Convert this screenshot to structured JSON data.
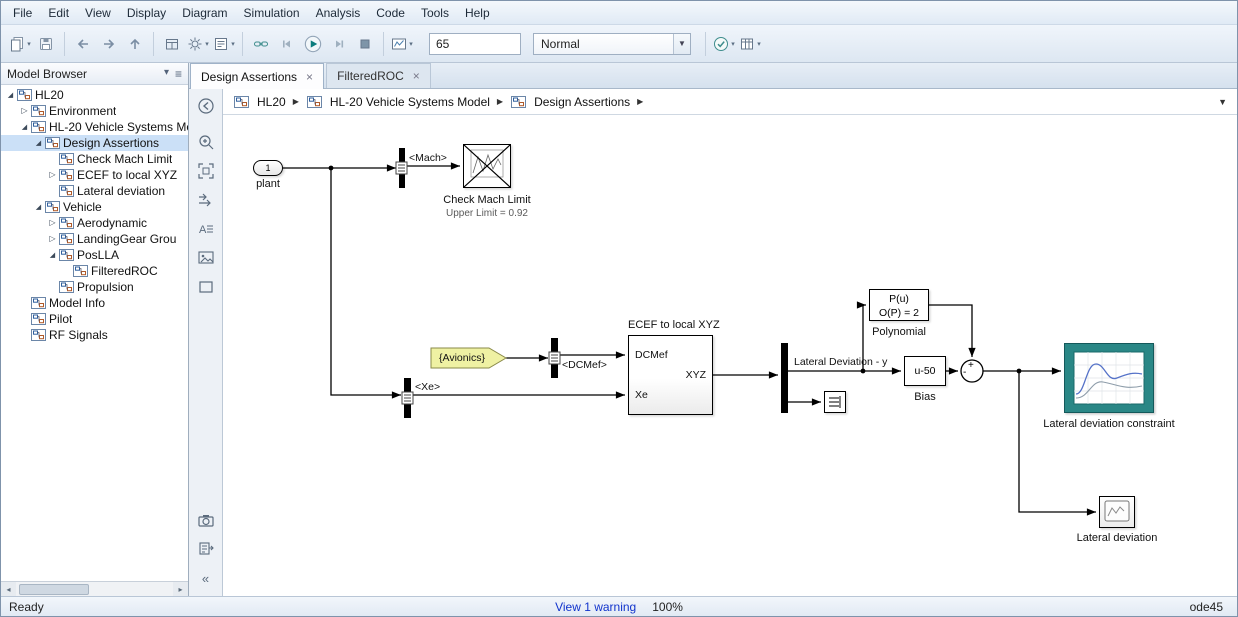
{
  "menu_bar": {
    "items": [
      "File",
      "Edit",
      "View",
      "Display",
      "Diagram",
      "Simulation",
      "Analysis",
      "Code",
      "Tools",
      "Help"
    ]
  },
  "toolbar": {
    "sim_stop_time": "65",
    "sim_mode": "Normal",
    "buttons": [
      "new-model",
      "save",
      "back",
      "forward",
      "up",
      "window-layout",
      "settings",
      "model-properties",
      "link",
      "step-back",
      "run",
      "step-forward",
      "stop",
      "simulation-data-display",
      "model-advisor",
      "build"
    ]
  },
  "model_browser": {
    "title": "Model Browser",
    "items": [
      {
        "label": "HL20",
        "depth": 0,
        "state": "expanded"
      },
      {
        "label": "Environment",
        "depth": 1,
        "state": "collapsed"
      },
      {
        "label": "HL-20 Vehicle Systems Mo",
        "depth": 1,
        "state": "expanded"
      },
      {
        "label": "Design Assertions",
        "depth": 2,
        "state": "expanded",
        "selected": true
      },
      {
        "label": "Check Mach Limit",
        "depth": 3,
        "state": "leaf"
      },
      {
        "label": "ECEF to local XYZ",
        "depth": 3,
        "state": "collapsed"
      },
      {
        "label": "Lateral deviation",
        "depth": 3,
        "state": "leaf"
      },
      {
        "label": "Vehicle",
        "depth": 2,
        "state": "expanded"
      },
      {
        "label": "Aerodynamic",
        "depth": 3,
        "state": "collapsed"
      },
      {
        "label": "LandingGear Grou",
        "depth": 3,
        "state": "collapsed"
      },
      {
        "label": "PosLLA",
        "depth": 3,
        "state": "expanded"
      },
      {
        "label": "FilteredROC",
        "depth": 4,
        "state": "leaf"
      },
      {
        "label": "Propulsion",
        "depth": 3,
        "state": "leaf"
      },
      {
        "label": "Model Info",
        "depth": 1,
        "state": "leaf"
      },
      {
        "label": "Pilot",
        "depth": 1,
        "state": "leaf"
      },
      {
        "label": "RF Signals",
        "depth": 1,
        "state": "leaf"
      }
    ]
  },
  "tabs": [
    {
      "label": "Design Assertions",
      "active": true
    },
    {
      "label": "FilteredROC",
      "active": false
    }
  ],
  "breadcrumb": {
    "crumbs": [
      "HL20",
      "HL-20 Vehicle Systems Model",
      "Design Assertions"
    ]
  },
  "palette": {
    "icons": [
      "back",
      "zoom",
      "fit-to-view",
      "pan-arrows",
      "annotation",
      "image",
      "draw-rectangle",
      "screenshot-camera",
      "copy-view",
      "collapse-palette"
    ]
  },
  "diagram": {
    "inport": {
      "number": "1",
      "label": "plant"
    },
    "signal_tags": {
      "mach": "<Mach>",
      "dcmef": "<DCMef>",
      "xe": "<Xe>",
      "avionics": "{Avionics}",
      "lateral": "Lateral Deviation - y"
    },
    "check_mach": {
      "label": "Check Mach Limit",
      "sublabel": "Upper Limit = 0.92"
    },
    "ecef": {
      "title": "ECEF to local XYZ",
      "port_in1": "DCMef",
      "port_in2": "Xe",
      "port_out": "XYZ"
    },
    "polynomial": {
      "line1": "P(u)",
      "line2": "O(P) = 2",
      "label": "Polynomial"
    },
    "bias": {
      "text": "u-50",
      "label": "Bias"
    },
    "sum": {
      "sign_top": "+",
      "sign_left": "-"
    },
    "constraint": {
      "label": "Lateral deviation constraint"
    },
    "scope": {
      "label": "Lateral deviation"
    }
  },
  "status_bar": {
    "left": "Ready",
    "warning_link": "View 1 warning",
    "zoom": "100%",
    "solver": "ode45"
  },
  "colors": {
    "constraint_teal": "#2a8786",
    "tag_yellow": "#eff1a3",
    "tree_selection": "#cbe0f7",
    "warning_link_blue": "#1133cc"
  }
}
